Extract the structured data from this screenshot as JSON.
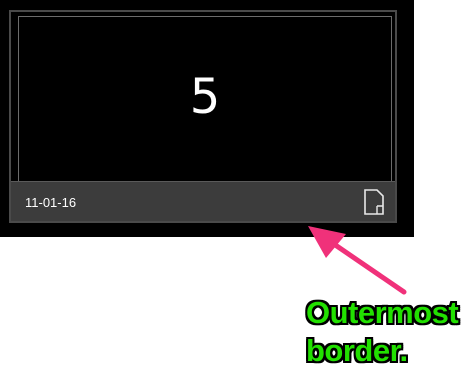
{
  "tile": {
    "number": "5",
    "date": "11-01-16",
    "icon": "document-icon"
  },
  "annotation": {
    "line1": "Outermost",
    "line2": "border.",
    "text_color": "#22e000",
    "arrow_color": "#f0317a"
  }
}
